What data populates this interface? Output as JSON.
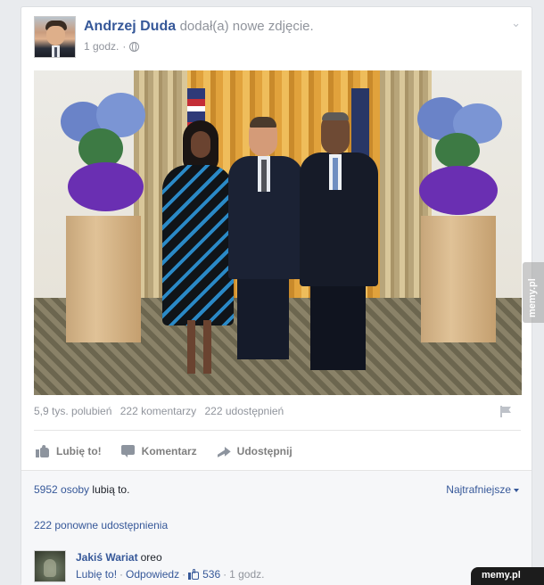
{
  "post": {
    "author": "Andrzej Duda",
    "action": "dodał(a) nowe zdjęcie.",
    "time": "1 godz."
  },
  "stats": {
    "likes": "5,9 tys. polubień",
    "comments": "222 komentarzy",
    "shares": "222 udostępnień"
  },
  "actions": {
    "like": "Lubię to!",
    "comment": "Komentarz",
    "share": "Udostępnij"
  },
  "feedback": {
    "likes_count": "5952 osoby",
    "likes_suffix": "lubią to.",
    "sort": "Najtrafniejsze",
    "reshares": "222 ponowne udostępnienia"
  },
  "comment": {
    "author": "Jakiś Wariat",
    "text": "oreo",
    "like": "Lubię to!",
    "reply": "Odpowiedz",
    "like_count": "536",
    "time": "1 godz.",
    "sep": "·"
  },
  "watermark": {
    "side": "memy.pl",
    "bottom": "memy.pl"
  },
  "colors": {
    "link": "#365899",
    "meta": "#90949c",
    "background": "#e9ebee"
  }
}
